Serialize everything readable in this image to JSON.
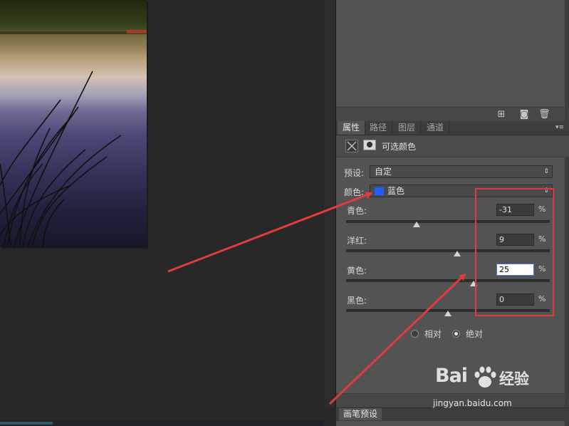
{
  "canvas": {
    "photo_label": ""
  },
  "top_panel": {
    "footer_icons": [
      "new-layer-comp-icon",
      "camera-icon",
      "trash-icon"
    ]
  },
  "tabs": [
    "属性",
    "路径",
    "图层",
    "通道"
  ],
  "active_tab": "属性",
  "properties": {
    "title": "可选颜色",
    "preset_label": "预设:",
    "preset_value": "自定",
    "colors_label": "颜色:",
    "colors_value": "蓝色",
    "swatch_color": "#1f5fff",
    "sliders": [
      {
        "label": "青色:",
        "value": "-31",
        "unit": "%",
        "position": -31
      },
      {
        "label": "洋红:",
        "value": "9",
        "unit": "%",
        "position": 9
      },
      {
        "label": "黄色:",
        "value": "25",
        "unit": "%",
        "position": 25,
        "focused": true
      },
      {
        "label": "黑色:",
        "value": "0",
        "unit": "%",
        "position": 0
      }
    ],
    "method": {
      "relative_label": "相对",
      "absolute_label": "绝对",
      "selected": "absolute"
    }
  },
  "bottom_tab": {
    "label": "画笔预设"
  },
  "watermark": {
    "logo": "Bai",
    "logo_suffix": "经验",
    "url": "jingyan.baidu.com"
  },
  "annotation_color": "#e03c3c"
}
